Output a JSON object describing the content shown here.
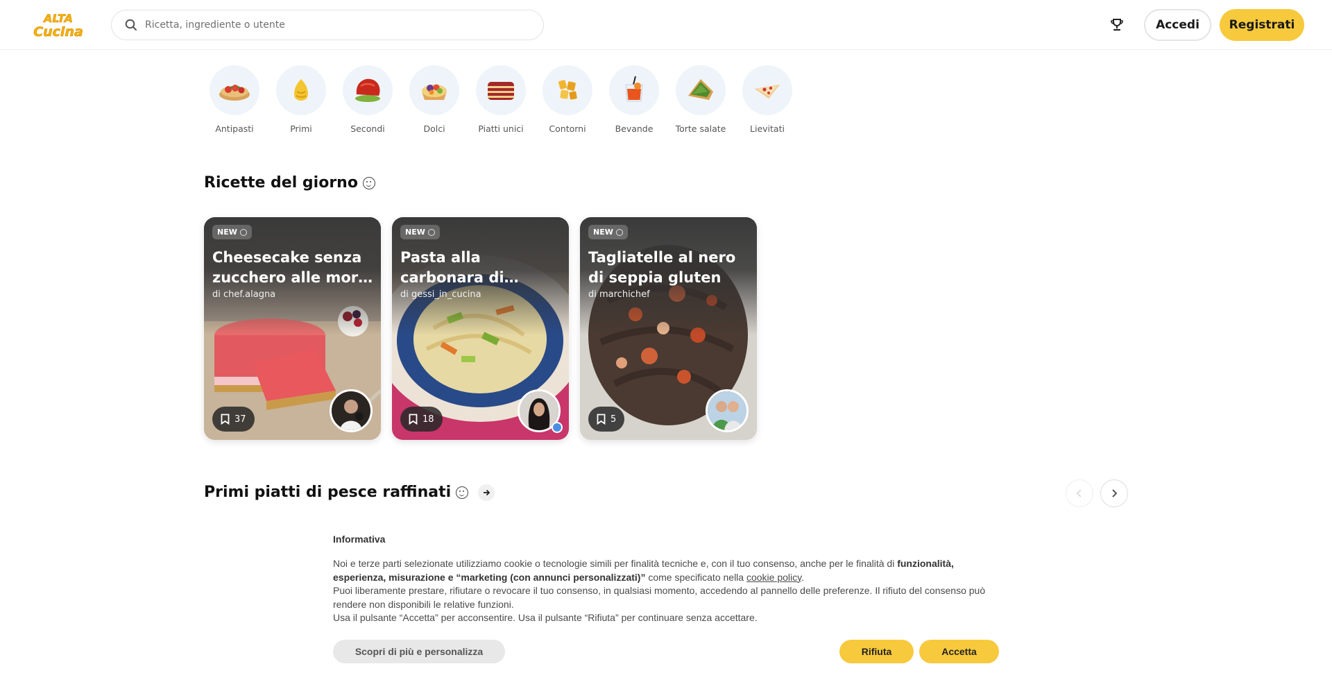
{
  "brand": {
    "logo_line1": "ALTA",
    "logo_line2": "Cucina",
    "color": "#f4b400"
  },
  "header": {
    "search_placeholder": "Ricetta, ingrediente o utente",
    "accedi_label": "Accedi",
    "registrati_label": "Registrati",
    "accent": "#f7c93c"
  },
  "categories": [
    {
      "label": "Antipasti",
      "icon": "bruschetta-icon"
    },
    {
      "label": "Primi",
      "icon": "pasta-icon"
    },
    {
      "label": "Secondi",
      "icon": "meat-icon"
    },
    {
      "label": "Dolci",
      "icon": "tart-icon"
    },
    {
      "label": "Piatti unici",
      "icon": "lasagna-icon"
    },
    {
      "label": "Contorni",
      "icon": "potatoes-icon"
    },
    {
      "label": "Bevande",
      "icon": "drink-icon"
    },
    {
      "label": "Torte salate",
      "icon": "quiche-icon"
    },
    {
      "label": "Lievitati",
      "icon": "pizza-icon"
    }
  ],
  "daily": {
    "title": "Ricette del giorno",
    "cards": [
      {
        "badge": "NEW",
        "title": "Cheesecake senza zucchero alle mor…",
        "author": "di chef.alagna",
        "saves": "37"
      },
      {
        "badge": "NEW",
        "title": "Pasta alla carbonara di…",
        "author": "di gessi_in_cucina",
        "saves": "18"
      },
      {
        "badge": "NEW",
        "title": "Tagliatelle al nero di seppia gluten free…",
        "author": "di marchichef",
        "saves": "5"
      }
    ]
  },
  "fish": {
    "title": "Primi piatti di pesce raffinati"
  },
  "cookie": {
    "title": "Informativa",
    "p1_a": "Noi e terze parti selezionate utilizziamo cookie o tecnologie simili per finalità tecniche e, con il tuo consenso, anche per le finalità di ",
    "p1_b": "funzionalità, esperienza, misurazione e “marketing (con annunci personalizzati)”",
    "p1_c": " come specificato nella ",
    "p1_link": "cookie policy",
    "p1_d": ".",
    "p2": "Puoi liberamente prestare, rifiutare o revocare il tuo consenso, in qualsiasi momento, accedendo al pannello delle preferenze. Il rifiuto del consenso può rendere non disponibili le relative funzioni.",
    "p3": "Usa il pulsante “Accetta” per acconsentire. Usa il pulsante “Rifiuta” per continuare senza accettare.",
    "scopri_label": "Scopri di più e personalizza",
    "rifiuta_label": "Rifiuta",
    "accetta_label": "Accetta"
  }
}
